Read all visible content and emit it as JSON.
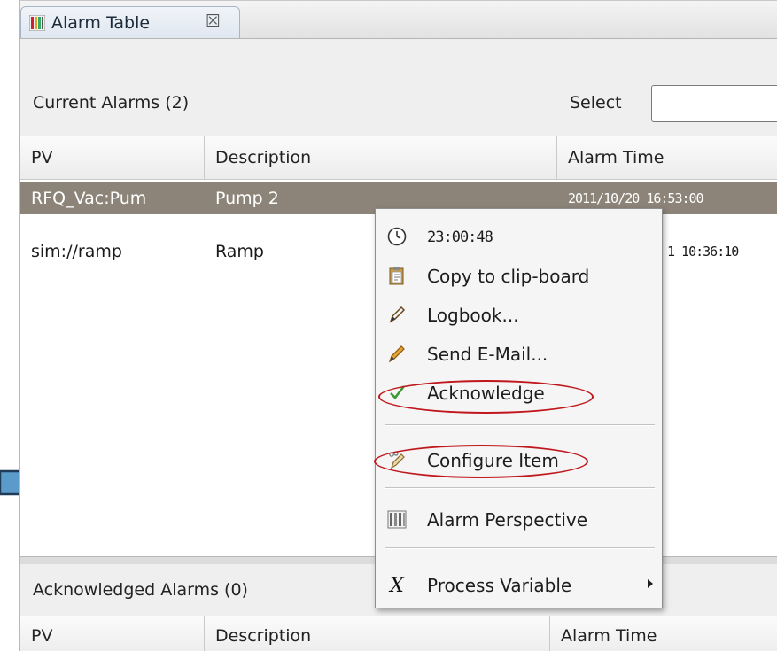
{
  "tab": {
    "title": "Alarm Table",
    "close_glyph": "☒"
  },
  "current": {
    "title": "Current Alarms (2)",
    "select_label": "Select",
    "columns": [
      "PV",
      "Description",
      "Alarm Time"
    ],
    "rows": [
      {
        "pv": "RFQ_Vac:Pum",
        "description": "Pump 2",
        "time": "2011/10/20 16:53:00",
        "selected": true
      },
      {
        "pv": "sim://ramp",
        "description": "Ramp",
        "time": "1 10:36:10",
        "selected": false
      }
    ]
  },
  "acknowledged": {
    "title": "Acknowledged Alarms (0)",
    "columns": [
      "PV",
      "Description",
      "Alarm Time"
    ]
  },
  "context_menu": {
    "items": [
      {
        "label": "23:00:48",
        "icon": "clock-icon"
      },
      {
        "label": "Copy to clip-board",
        "icon": "clipboard-icon"
      },
      {
        "label": "Logbook...",
        "icon": "pencil-icon"
      },
      {
        "label": "Send E-Mail...",
        "icon": "pen-icon"
      },
      {
        "label": "Acknowledge",
        "icon": "checkmark-icon",
        "highlighted": true
      },
      {
        "label": "Configure Item",
        "icon": "configure-icon",
        "highlighted": true
      },
      {
        "label": "Alarm Perspective",
        "icon": "alarm-table-icon"
      },
      {
        "label": "Process Variable",
        "icon": "process-variable-icon",
        "submenu": true
      }
    ]
  },
  "colors": {
    "highlight_ellipse": "#c0171d",
    "arrow_fill": "#5b9bc9",
    "selected_row": "#8c8479"
  }
}
